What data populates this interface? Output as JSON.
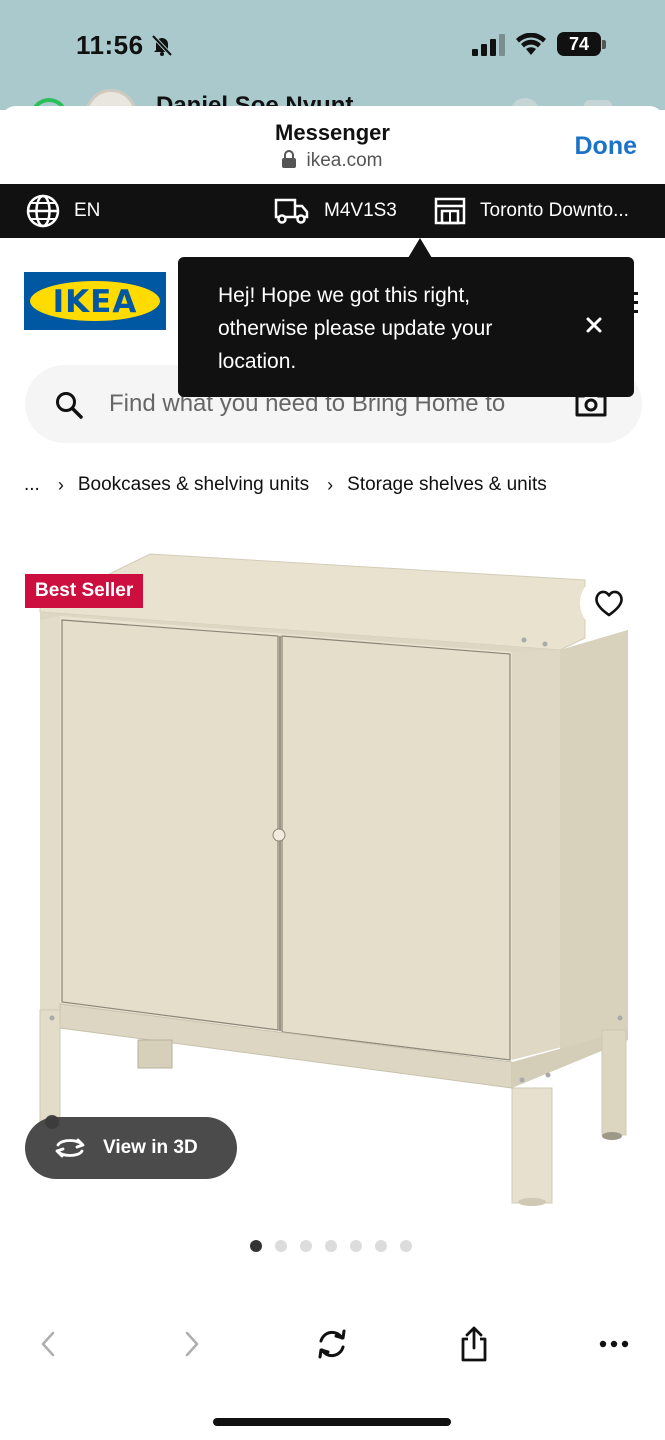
{
  "status_bar": {
    "time": "11:56",
    "battery": "74",
    "icons": [
      "bell-muted-icon",
      "cell-signal-icon",
      "wifi-icon",
      "battery-icon"
    ]
  },
  "peek": {
    "name": "Daniel Soe Nyunt"
  },
  "sheet": {
    "title": "Messenger",
    "url": "ikea.com",
    "done_label": "Done"
  },
  "topbar": {
    "language": "EN",
    "postal_code": "M4V1S3",
    "store": "Toronto Downto..."
  },
  "logo": {
    "text": "IKEA"
  },
  "tooltip": {
    "message": "Hej! Hope we got this right, otherwise please update your location."
  },
  "search": {
    "placeholder": "Find what you need to Bring Home to"
  },
  "breadcrumb": {
    "ellipsis": "...",
    "items": [
      "Bookcases & shelving units",
      "Storage shelves & units"
    ]
  },
  "product": {
    "badge": "Best Seller",
    "view_3d_label": "View in 3D",
    "image_count": 7,
    "active_image": 1
  },
  "colors": {
    "ikea_blue": "#0058a3",
    "ikea_yellow": "#ffdb00",
    "badge_red": "#cc0f3e",
    "done_blue": "#1a73c8",
    "status_bg": "#a9c9cc"
  }
}
